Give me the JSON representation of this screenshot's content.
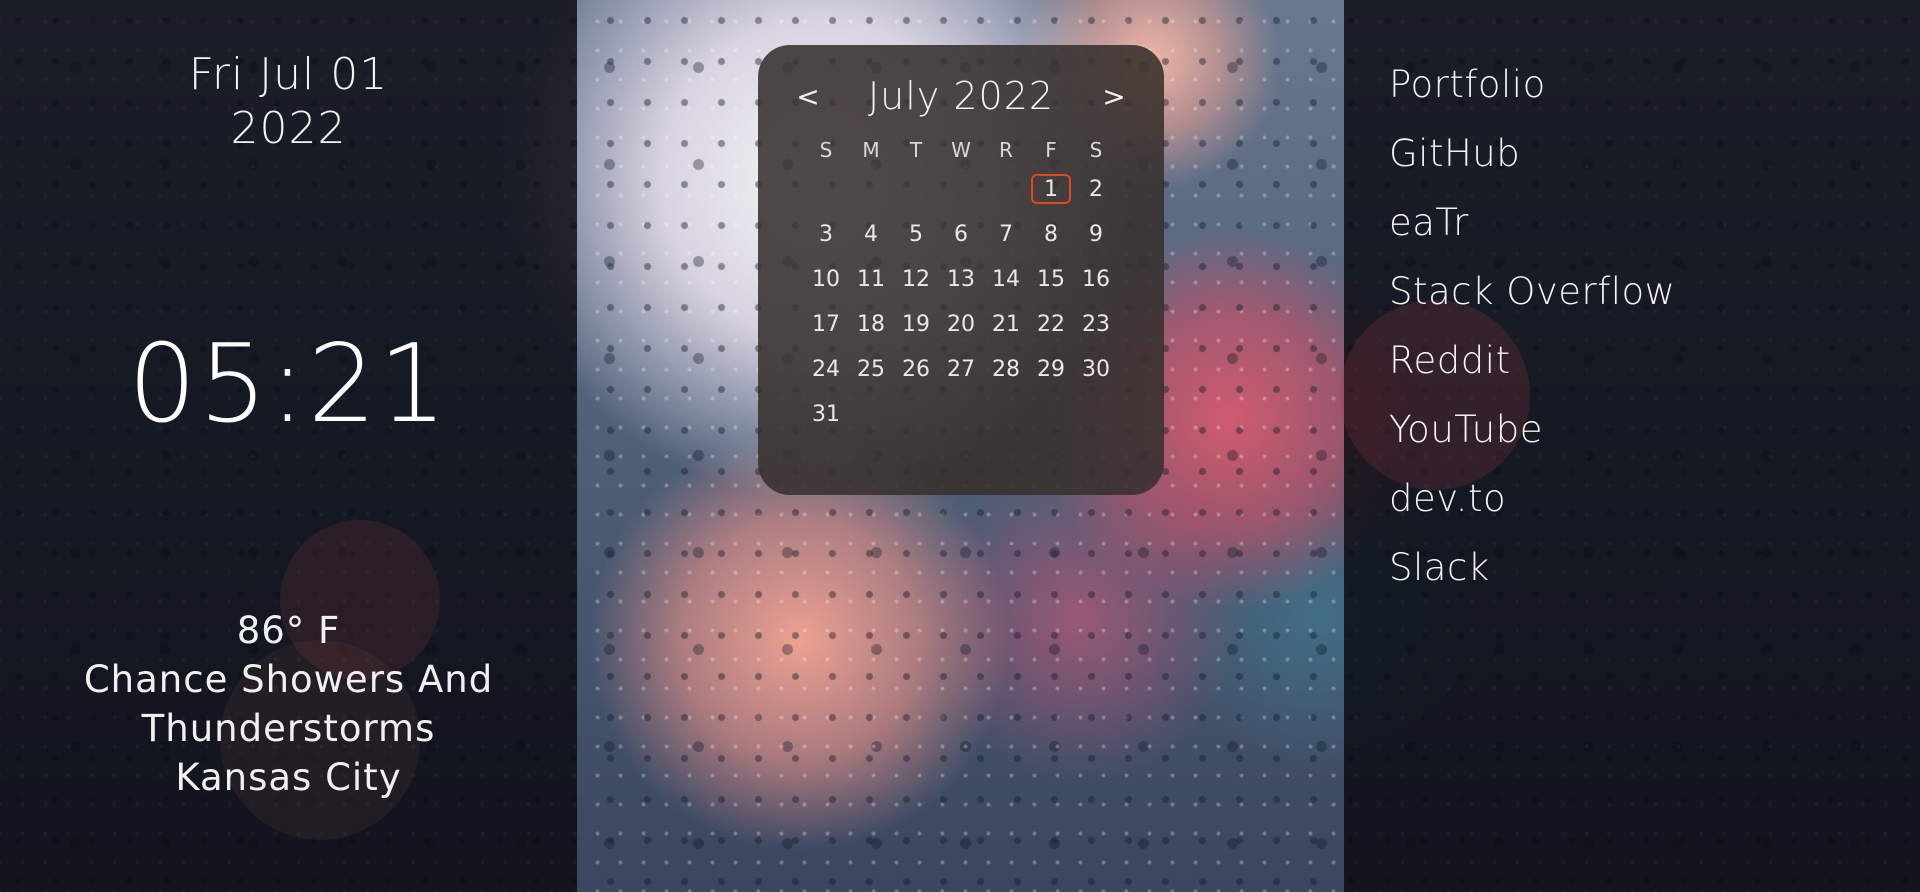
{
  "date": {
    "line1": "Fri Jul 01",
    "line2": "2022"
  },
  "clock": {
    "time": "05:21"
  },
  "weather": {
    "temperature": "86° F",
    "condition_line1": "Chance Showers And",
    "condition_line2": "Thunderstorms",
    "location": "Kansas City"
  },
  "calendar": {
    "title": "July 2022",
    "prev": "<",
    "next": ">",
    "weekdays": [
      "S",
      "M",
      "T",
      "W",
      "R",
      "F",
      "S"
    ],
    "leading_blanks": 5,
    "days": [
      "1",
      "2",
      "3",
      "4",
      "5",
      "6",
      "7",
      "8",
      "9",
      "10",
      "11",
      "12",
      "13",
      "14",
      "15",
      "16",
      "17",
      "18",
      "19",
      "20",
      "21",
      "22",
      "23",
      "24",
      "25",
      "26",
      "27",
      "28",
      "29",
      "30",
      "31"
    ],
    "today": "1",
    "accent_color": "#e0491e"
  },
  "links": [
    {
      "label": "Portfolio"
    },
    {
      "label": "GitHub"
    },
    {
      "label": "eaTr"
    },
    {
      "label": "Stack Overflow"
    },
    {
      "label": "Reddit"
    },
    {
      "label": "YouTube"
    },
    {
      "label": "dev.to"
    },
    {
      "label": "Slack"
    }
  ]
}
